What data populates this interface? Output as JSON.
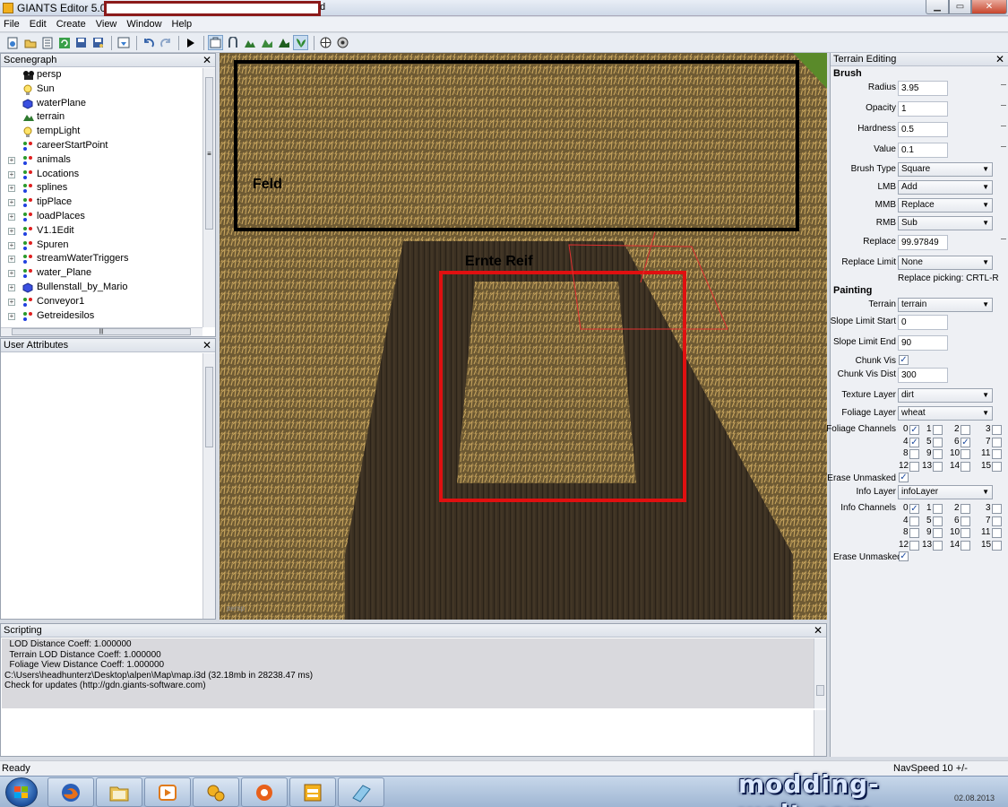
{
  "window": {
    "title": "GIANTS Editor 5.0.1",
    "title_suffix": "d",
    "minimize": "▁",
    "maximize": "▭",
    "close": "✕"
  },
  "menu": [
    "File",
    "Edit",
    "Create",
    "View",
    "Window",
    "Help"
  ],
  "scenegraph": {
    "title": "Scenegraph",
    "close": "✕",
    "items": [
      {
        "label": "persp",
        "icon": "camera-icon",
        "expandable": false
      },
      {
        "label": "Sun",
        "icon": "light-icon",
        "expandable": false
      },
      {
        "label": "waterPlane",
        "icon": "cube-icon",
        "expandable": false
      },
      {
        "label": "terrain",
        "icon": "terrain-icon",
        "expandable": false
      },
      {
        "label": "tempLight",
        "icon": "light-icon",
        "expandable": false
      },
      {
        "label": "careerStartPoint",
        "icon": "transformgroup-icon",
        "expandable": false
      },
      {
        "label": "animals",
        "icon": "transformgroup-icon",
        "expandable": true
      },
      {
        "label": "Locations",
        "icon": "transformgroup-icon",
        "expandable": true
      },
      {
        "label": "splines",
        "icon": "transformgroup-icon",
        "expandable": true
      },
      {
        "label": "tipPlace",
        "icon": "transformgroup-icon",
        "expandable": true
      },
      {
        "label": "loadPlaces",
        "icon": "transformgroup-icon",
        "expandable": true
      },
      {
        "label": "V1.1Edit",
        "icon": "transformgroup-icon",
        "expandable": true
      },
      {
        "label": "Spuren",
        "icon": "transformgroup-icon",
        "expandable": true
      },
      {
        "label": "streamWaterTriggers",
        "icon": "transformgroup-icon",
        "expandable": true
      },
      {
        "label": "water_Plane",
        "icon": "transformgroup-icon",
        "expandable": true
      },
      {
        "label": "Bullenstall_by_Mario",
        "icon": "cube-icon",
        "expandable": true
      },
      {
        "label": "Conveyor1",
        "icon": "transformgroup-icon",
        "expandable": true
      },
      {
        "label": "Getreidesilos",
        "icon": "transformgroup-icon",
        "expandable": true
      }
    ],
    "scroll_marker": "≡",
    "hscroll_marker": "|||"
  },
  "user_attributes": {
    "title": "User Attributes",
    "close": "✕"
  },
  "viewport": {
    "label_feld": "Feld",
    "label_ernte": "Ernte Reif",
    "camera": "persp"
  },
  "terrain_editing": {
    "title": "Terrain Editing",
    "close": "✕",
    "brush_header": "Brush",
    "radius_label": "Radius",
    "radius": "3.95",
    "opacity_label": "Opacity",
    "opacity": "1",
    "hardness_label": "Hardness",
    "hardness": "0.5",
    "value_label": "Value",
    "value": "0.1",
    "brush_type_label": "Brush Type",
    "brush_type": "Square",
    "lmb_label": "LMB",
    "lmb": "Add",
    "mmb_label": "MMB",
    "mmb": "Replace",
    "rmb_label": "RMB",
    "rmb": "Sub",
    "replace_label": "Replace",
    "replace": "99.97849",
    "replace_limit_label": "Replace Limit",
    "replace_limit": "None",
    "replace_picking": "Replace picking: CRTL-R",
    "painting_header": "Painting",
    "terrain_label": "Terrain",
    "terrain": "terrain",
    "slope_start_label": "Slope Limit Start",
    "slope_start": "0",
    "slope_end_label": "Slope Limit End",
    "slope_end": "90",
    "chunk_vis_label": "Chunk Vis",
    "chunk_vis_dist_label": "Chunk Vis Dist",
    "chunk_vis_dist": "300",
    "texture_layer_label": "Texture Layer",
    "texture_layer": "dirt",
    "foliage_layer_label": "Foliage Layer",
    "foliage_layer": "wheat",
    "foliage_channels_label": "Foliage Channels",
    "foliage_channels": [
      {
        "n": "0",
        "checked": true
      },
      {
        "n": "1",
        "checked": false
      },
      {
        "n": "2",
        "checked": false
      },
      {
        "n": "3",
        "checked": false
      },
      {
        "n": "4",
        "checked": true
      },
      {
        "n": "5",
        "checked": false
      },
      {
        "n": "6",
        "checked": true
      },
      {
        "n": "7",
        "checked": false
      },
      {
        "n": "8",
        "checked": false
      },
      {
        "n": "9",
        "checked": false
      },
      {
        "n": "10",
        "checked": false
      },
      {
        "n": "11",
        "checked": false
      },
      {
        "n": "12",
        "checked": false
      },
      {
        "n": "13",
        "checked": false
      },
      {
        "n": "14",
        "checked": false
      },
      {
        "n": "15",
        "checked": false
      }
    ],
    "erase_unmasked_label": "Erase Unmasked",
    "info_layer_label": "Info Layer",
    "info_layer": "infoLayer",
    "info_channels_label": "Info Channels",
    "info_channels": [
      {
        "n": "0",
        "checked": true
      },
      {
        "n": "1",
        "checked": false
      },
      {
        "n": "2",
        "checked": false
      },
      {
        "n": "3",
        "checked": false
      },
      {
        "n": "4",
        "checked": false
      },
      {
        "n": "5",
        "checked": false
      },
      {
        "n": "6",
        "checked": false
      },
      {
        "n": "7",
        "checked": false
      },
      {
        "n": "8",
        "checked": false
      },
      {
        "n": "9",
        "checked": false
      },
      {
        "n": "10",
        "checked": false
      },
      {
        "n": "11",
        "checked": false
      },
      {
        "n": "12",
        "checked": false
      },
      {
        "n": "13",
        "checked": false
      },
      {
        "n": "14",
        "checked": false
      },
      {
        "n": "15",
        "checked": false
      }
    ],
    "erase_unmasked2_label": "Erase Unmasked",
    "check": "✓",
    "dropdown_arrow": "▼"
  },
  "scripting": {
    "title": "Scripting",
    "close": "✕",
    "log": "  LOD Distance Coeff: 1.000000\n  Terrain LOD Distance Coeff: 1.000000\n  Foliage View Distance Coeff: 1.000000\nC:\\Users\\headhunterz\\Desktop\\alpen\\Map\\map.i3d (32.18mb in 28238.47 ms)\nCheck for updates (http://gdn.giants-software.com)"
  },
  "status": {
    "ready": "Ready",
    "navspeed": "NavSpeed 10 +/-"
  },
  "taskbar": {
    "watermark": "modding-welt.com",
    "date": "02.08.2013"
  },
  "colors": {
    "annotation_black": "#000000",
    "annotation_red": "#e01010",
    "wheat": "#b38f4a",
    "soil": "#3a2f1c"
  }
}
